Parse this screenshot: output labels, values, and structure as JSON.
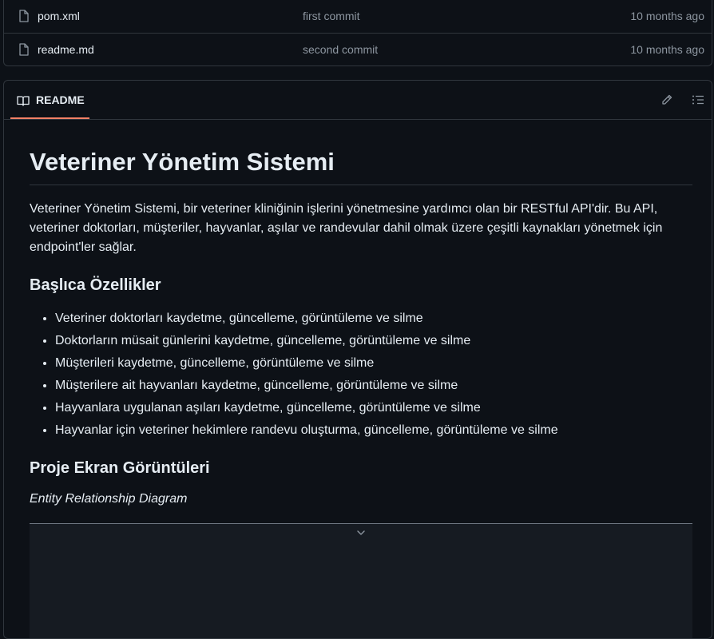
{
  "files": [
    {
      "name": "pom.xml",
      "message": "first commit",
      "date": "10 months ago",
      "icon": "file-icon"
    },
    {
      "name": "readme.md",
      "message": "second commit",
      "date": "10 months ago",
      "icon": "file-icon"
    }
  ],
  "readme": {
    "tab_label": "README",
    "tab_icon": "book-icon",
    "edit_icon": "pencil-icon",
    "outline_icon": "list-icon",
    "accent_color": "#f78166",
    "title": "Veteriner Yönetim Sistemi",
    "intro": "Veteriner Yönetim Sistemi, bir veteriner kliniğinin işlerini yönetmesine yardımcı olan bir RESTful API'dir. Bu API, veteriner doktorları, müşteriler, hayvanlar, aşılar ve randevular dahil olmak üzere çeşitli kaynakları yönetmek için endpoint'ler sağlar.",
    "features_heading": "Başlıca Özellikler",
    "features": [
      "Veteriner doktorları kaydetme, güncelleme, görüntüleme ve silme",
      "Doktorların müsait günlerini kaydetme, güncelleme, görüntüleme ve silme",
      "Müşterileri kaydetme, güncelleme, görüntüleme ve silme",
      "Müşterilere ait hayvanları kaydetme, güncelleme, görüntüleme ve silme",
      "Hayvanlara uygulanan aşıları kaydetme, güncelleme, görüntüleme ve silme",
      "Hayvanlar için veteriner hekimlere randevu oluşturma, güncelleme, görüntüleme ve silme"
    ],
    "screenshots_heading": "Proje Ekran Görüntüleri",
    "erd_caption": "Entity Relationship Diagram",
    "expand_icon": "chevron-down-icon"
  }
}
